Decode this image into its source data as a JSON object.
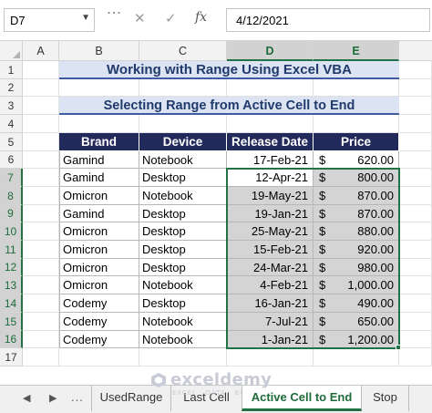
{
  "formula_bar": {
    "name_box": "D7",
    "name_box_arrow_icon": "chevron-down-icon",
    "cancel_icon": "✕",
    "enter_icon": "✓",
    "fx_label": "fx",
    "formula_value": "4/12/2021"
  },
  "columns": [
    "A",
    "B",
    "C",
    "D",
    "E"
  ],
  "rows": [
    "1",
    "2",
    "3",
    "4",
    "5",
    "6",
    "7",
    "8",
    "9",
    "10",
    "11",
    "12",
    "13",
    "14",
    "15",
    "16",
    "17"
  ],
  "sheet": {
    "title": "Working with Range Using Excel VBA",
    "subtitle": "Selecting Range from Active Cell to End",
    "table": {
      "headers": [
        "Brand",
        "Device",
        "Release Date",
        "Price"
      ],
      "rows": [
        {
          "brand": "Gamind",
          "device": "Notebook",
          "date": "17-Feb-21",
          "currency": "$",
          "price": "620.00"
        },
        {
          "brand": "Gamind",
          "device": "Desktop",
          "date": "12-Apr-21",
          "currency": "$",
          "price": "800.00"
        },
        {
          "brand": "Omicron",
          "device": "Notebook",
          "date": "19-May-21",
          "currency": "$",
          "price": "870.00"
        },
        {
          "brand": "Gamind",
          "device": "Desktop",
          "date": "19-Jan-21",
          "currency": "$",
          "price": "870.00"
        },
        {
          "brand": "Omicron",
          "device": "Desktop",
          "date": "25-May-21",
          "currency": "$",
          "price": "880.00"
        },
        {
          "brand": "Omicron",
          "device": "Desktop",
          "date": "15-Feb-21",
          "currency": "$",
          "price": "920.00"
        },
        {
          "brand": "Omicron",
          "device": "Desktop",
          "date": "24-Mar-21",
          "currency": "$",
          "price": "980.00"
        },
        {
          "brand": "Omicron",
          "device": "Notebook",
          "date": "4-Feb-21",
          "currency": "$",
          "price": "1,000.00"
        },
        {
          "brand": "Codemy",
          "device": "Desktop",
          "date": "16-Jan-21",
          "currency": "$",
          "price": "490.00"
        },
        {
          "brand": "Codemy",
          "device": "Notebook",
          "date": "7-Jul-21",
          "currency": "$",
          "price": "650.00"
        },
        {
          "brand": "Codemy",
          "device": "Notebook",
          "date": "1-Jan-21",
          "currency": "$",
          "price": "1,200.00"
        }
      ]
    }
  },
  "tabs": {
    "prev_icon": "◀",
    "next_icon": "▶",
    "more_label": "...",
    "items": [
      "UsedRange",
      "Last Cell",
      "Active Cell to End",
      "Stop"
    ],
    "active": "Active Cell to End"
  },
  "watermark": {
    "logo_icon": "exceldemy-logo-icon",
    "text": "exceldemy",
    "subtext": "EXCEL · DATA · BI"
  },
  "colors": {
    "header_fill": "#222a5c",
    "title_fill": "#dce3f3",
    "selection_border": "#217346",
    "selection_fill": "#d4d4d4"
  }
}
